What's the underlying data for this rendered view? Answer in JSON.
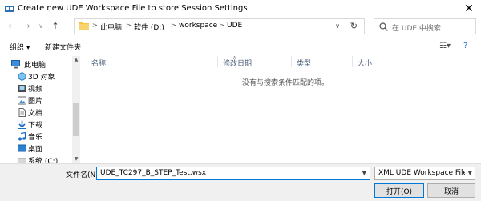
{
  "window": {
    "title": "Create new UDE Workspace File to store Session Settings",
    "close_glyph": "✕"
  },
  "nav": {
    "back_glyph": "←",
    "forward_glyph": "→",
    "history_glyph": "∨",
    "up_glyph": "↑"
  },
  "address": {
    "crumbs": [
      "此电脑",
      "软件 (D:)",
      "workspace",
      "UDE"
    ],
    "separator": ">"
  },
  "search": {
    "placeholder": "在 UDE 中搜索"
  },
  "toolbar": {
    "organize": "组织 ▾",
    "new_folder": "新建文件夹"
  },
  "sidebar": {
    "items": [
      {
        "label": "此电脑",
        "icon": "computer-icon"
      },
      {
        "label": "3D 对象",
        "icon": "3d-objects-icon"
      },
      {
        "label": "视频",
        "icon": "video-icon"
      },
      {
        "label": "图片",
        "icon": "pictures-icon"
      },
      {
        "label": "文档",
        "icon": "documents-icon"
      },
      {
        "label": "下载",
        "icon": "downloads-icon"
      },
      {
        "label": "音乐",
        "icon": "music-icon"
      },
      {
        "label": "桌面",
        "icon": "desktop-icon"
      },
      {
        "label": "系统 (C:)",
        "icon": "drive-icon"
      }
    ]
  },
  "columns": [
    "名称",
    "修改日期",
    "类型",
    "大小"
  ],
  "empty_message": "没有与搜索条件匹配的项。",
  "filename": {
    "label": "文件名(N):",
    "value": "UDE_TC297_B_STEP_Test.wsx"
  },
  "filetype": {
    "selected": "XML UDE Workspace Files (*"
  },
  "buttons": {
    "open": "打开(O)",
    "cancel": "取消"
  },
  "colors": {
    "accent": "#0078d7",
    "folder": "#f4c542"
  }
}
